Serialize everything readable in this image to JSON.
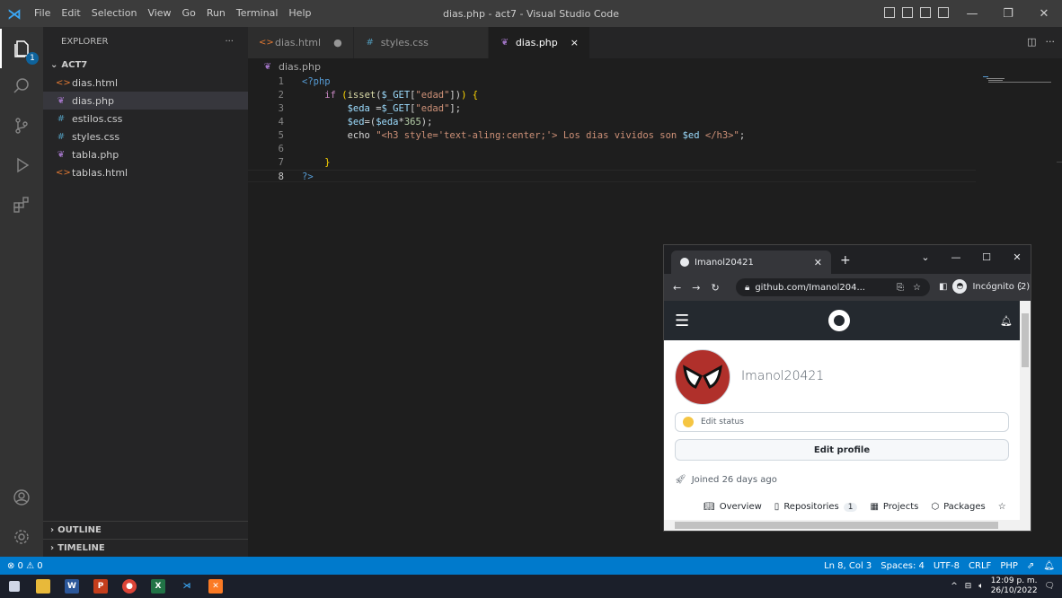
{
  "titlebar": {
    "menu": [
      "File",
      "Edit",
      "Selection",
      "View",
      "Go",
      "Run",
      "Terminal",
      "Help"
    ],
    "window_title": "dias.php - act7 - Visual Studio Code"
  },
  "sidebar": {
    "title": "EXPLORER",
    "more": "···",
    "folder": "ACT7",
    "files": [
      {
        "name": "dias.html",
        "type": "html"
      },
      {
        "name": "dias.php",
        "type": "php"
      },
      {
        "name": "estilos.css",
        "type": "css"
      },
      {
        "name": "styles.css",
        "type": "css"
      },
      {
        "name": "tabla.php",
        "type": "php"
      },
      {
        "name": "tablas.html",
        "type": "html"
      }
    ],
    "outline": "OUTLINE",
    "timeline": "TIMELINE"
  },
  "tabs": [
    {
      "label": "dias.html",
      "icon": "<>",
      "suffix": "●"
    },
    {
      "label": "styles.css",
      "icon": "#",
      "suffix": ""
    },
    {
      "label": "dias.php",
      "icon": "php",
      "suffix": "×"
    }
  ],
  "breadcrumb": "dias.php",
  "editor": {
    "line_numbers": [
      "1",
      "2",
      "3",
      "4",
      "5",
      "6",
      "7",
      "8"
    ]
  },
  "statusbar": {
    "left": "⊗ 0 ⚠ 0",
    "items": [
      "Ln 8, Col 3",
      "Spaces: 4",
      "UTF-8",
      "CRLF",
      "PHP"
    ]
  },
  "taskbar": {
    "time": "12:09 p. m.",
    "date": "26/10/2022"
  },
  "browser": {
    "tab_title": "Imanol20421",
    "url": "github.com/Imanol204...",
    "incognito": "Incógnito (2)",
    "username": "Imanol20421",
    "edit_status": "Edit status",
    "edit_profile": "Edit profile",
    "joined": "Joined 26 days ago",
    "nav": {
      "overview": "Overview",
      "repositories": "Repositories",
      "repositories_count": "1",
      "projects": "Projects",
      "packages": "Packages"
    }
  },
  "colors": {
    "status_bar": "#007acc",
    "activity_bar": "#333333",
    "editor_bg": "#1e1e1e",
    "github_header": "#24292f"
  }
}
